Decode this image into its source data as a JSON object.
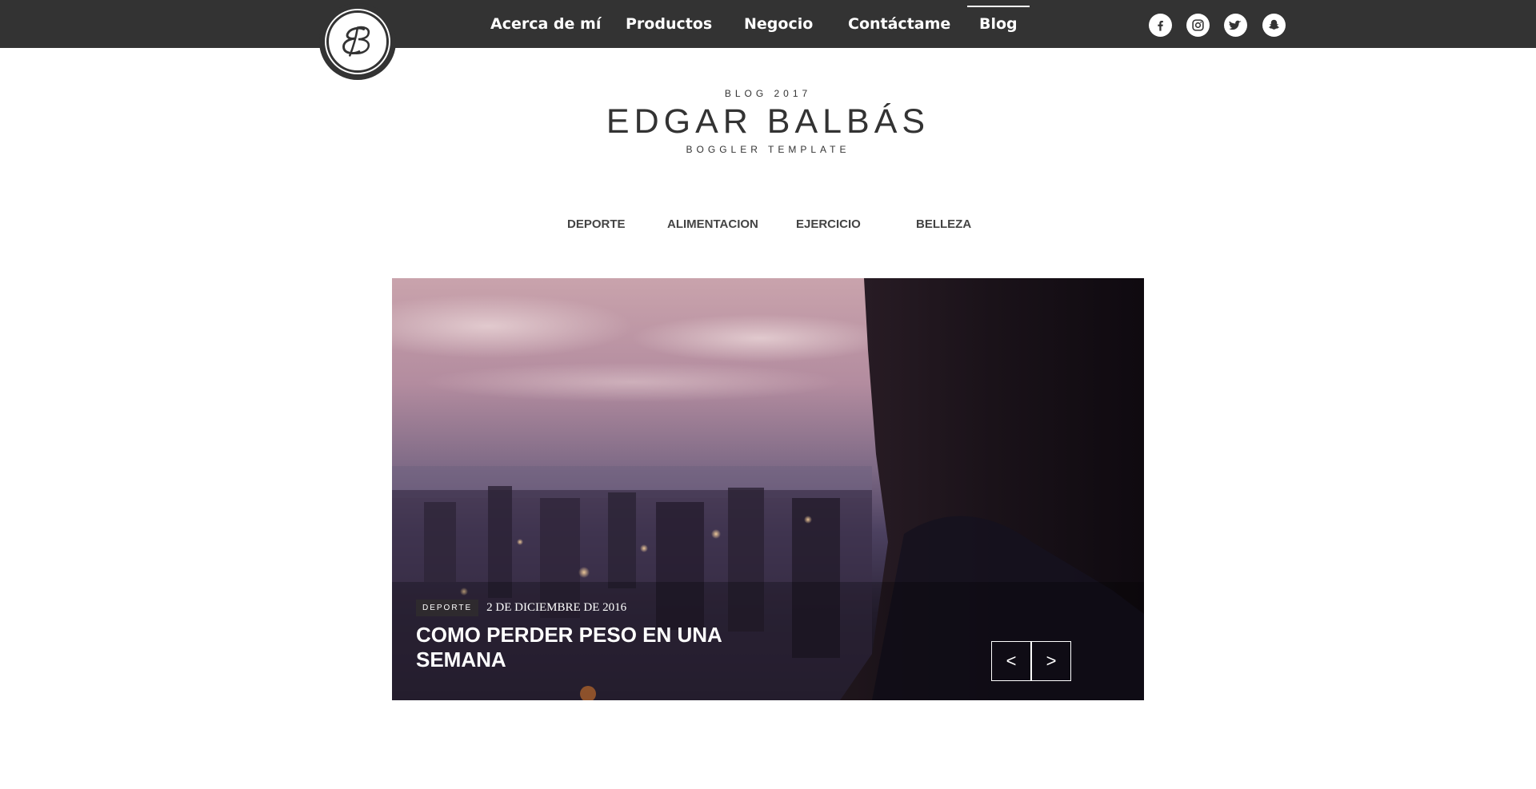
{
  "nav": {
    "items": [
      {
        "label": "Acerca de mí",
        "active": false
      },
      {
        "label": "Productos",
        "active": false
      },
      {
        "label": "Negocio",
        "active": false
      },
      {
        "label": "Contáctame",
        "active": false
      },
      {
        "label": "Blog",
        "active": true
      }
    ]
  },
  "logo": {
    "text": "EB"
  },
  "social": [
    "facebook-icon",
    "instagram-icon",
    "twitter-icon",
    "snapchat-icon"
  ],
  "header": {
    "year": "BLOG 2017",
    "title": "EDGAR BALBÁS",
    "subtitle": "BOGGLER TEMPLATE"
  },
  "categories": [
    "DEPORTE",
    "ALIMENTACION",
    "EJERCICIO",
    "BELLEZA"
  ],
  "slide": {
    "category": "DEPORTE",
    "date": "2 DE DICIEMBRE DE 2016",
    "title": "COMO PERDER PESO EN UNA SEMANA",
    "prev": "<",
    "next": ">"
  },
  "colors": {
    "topbar": "#333333",
    "text": "#333333",
    "white": "#ffffff"
  }
}
